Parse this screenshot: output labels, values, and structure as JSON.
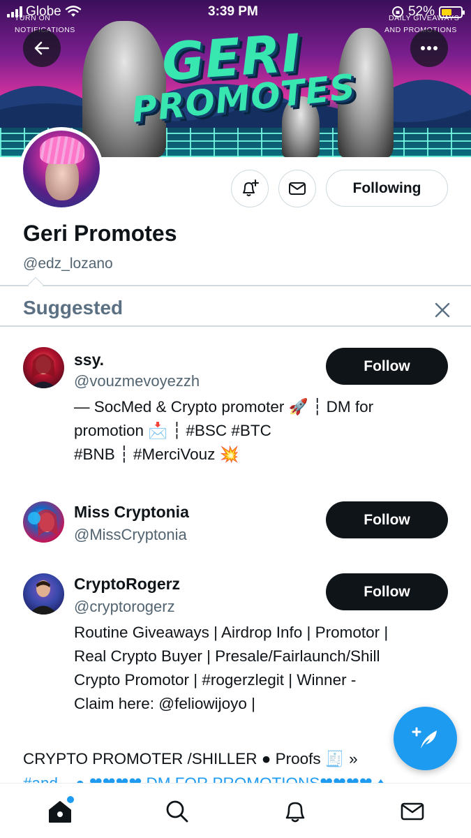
{
  "status_bar": {
    "carrier": "Globe",
    "time": "3:39 PM",
    "battery_percent": "52%",
    "battery_level": 0.52,
    "battery_color": "#ffd60a"
  },
  "banner": {
    "title_line1": "GERI",
    "title_line2": "PROMOTES",
    "note_left": "TURN ON\nNOTIFICATIONS",
    "note_left_1": "TURN ON",
    "note_left_2": "NOTIFICATIONS",
    "note_right_1": "DAILY GIVEAWAYS",
    "note_right_2": "AND PROMOTIONS"
  },
  "profile": {
    "name": "Geri Promotes",
    "handle": "@edz_lozano",
    "following_label": "Following"
  },
  "suggested": {
    "title": "Suggested",
    "accounts": [
      {
        "name": "ssy.",
        "handle": "@vouzmevoyezzh",
        "bio_lines": [
          "— SocMed & Crypto promoter 🚀 ┆ DM for",
          "promotion 📩 ┆ #BSC #BTC",
          "#BNB ┆ #MerciVouz 💥"
        ],
        "button": "Follow"
      },
      {
        "name": "Miss Cryptonia",
        "handle": "@MissCryptonia",
        "bio_lines": [],
        "button": "Follow"
      },
      {
        "name": "CryptoRogerz",
        "handle": "@cryptorogerz",
        "bio_lines": [
          "Routine Giveaways | Airdrop Info | Promotor |",
          "Real Crypto Buyer | Presale/Fairlaunch/Shill",
          "Crypto Promotor | #rogerzlegit | Winner -",
          "Claim here: @feliowijoyo |"
        ],
        "button": "Follow"
      }
    ]
  },
  "bottom_bio": {
    "line1": "CRYPTO PROMOTER /SHILLER ● Proofs 🧾 »",
    "line2": "#and... ● ❤❤❤❤ DM FOR PROMOTIONS❤❤❤❤ ♦"
  },
  "icons": {
    "back": "back-arrow-icon",
    "more": "more-icon",
    "notify": "bell-plus-icon",
    "message": "mail-icon",
    "close": "close-icon",
    "compose": "compose-feather-icon",
    "nav": [
      "home-icon",
      "search-icon",
      "bell-icon",
      "mail-icon"
    ]
  },
  "colors": {
    "accent": "#1d9bf0",
    "text": "#0f1419",
    "secondary_text": "#536471",
    "suggested_title": "#5b7083"
  }
}
